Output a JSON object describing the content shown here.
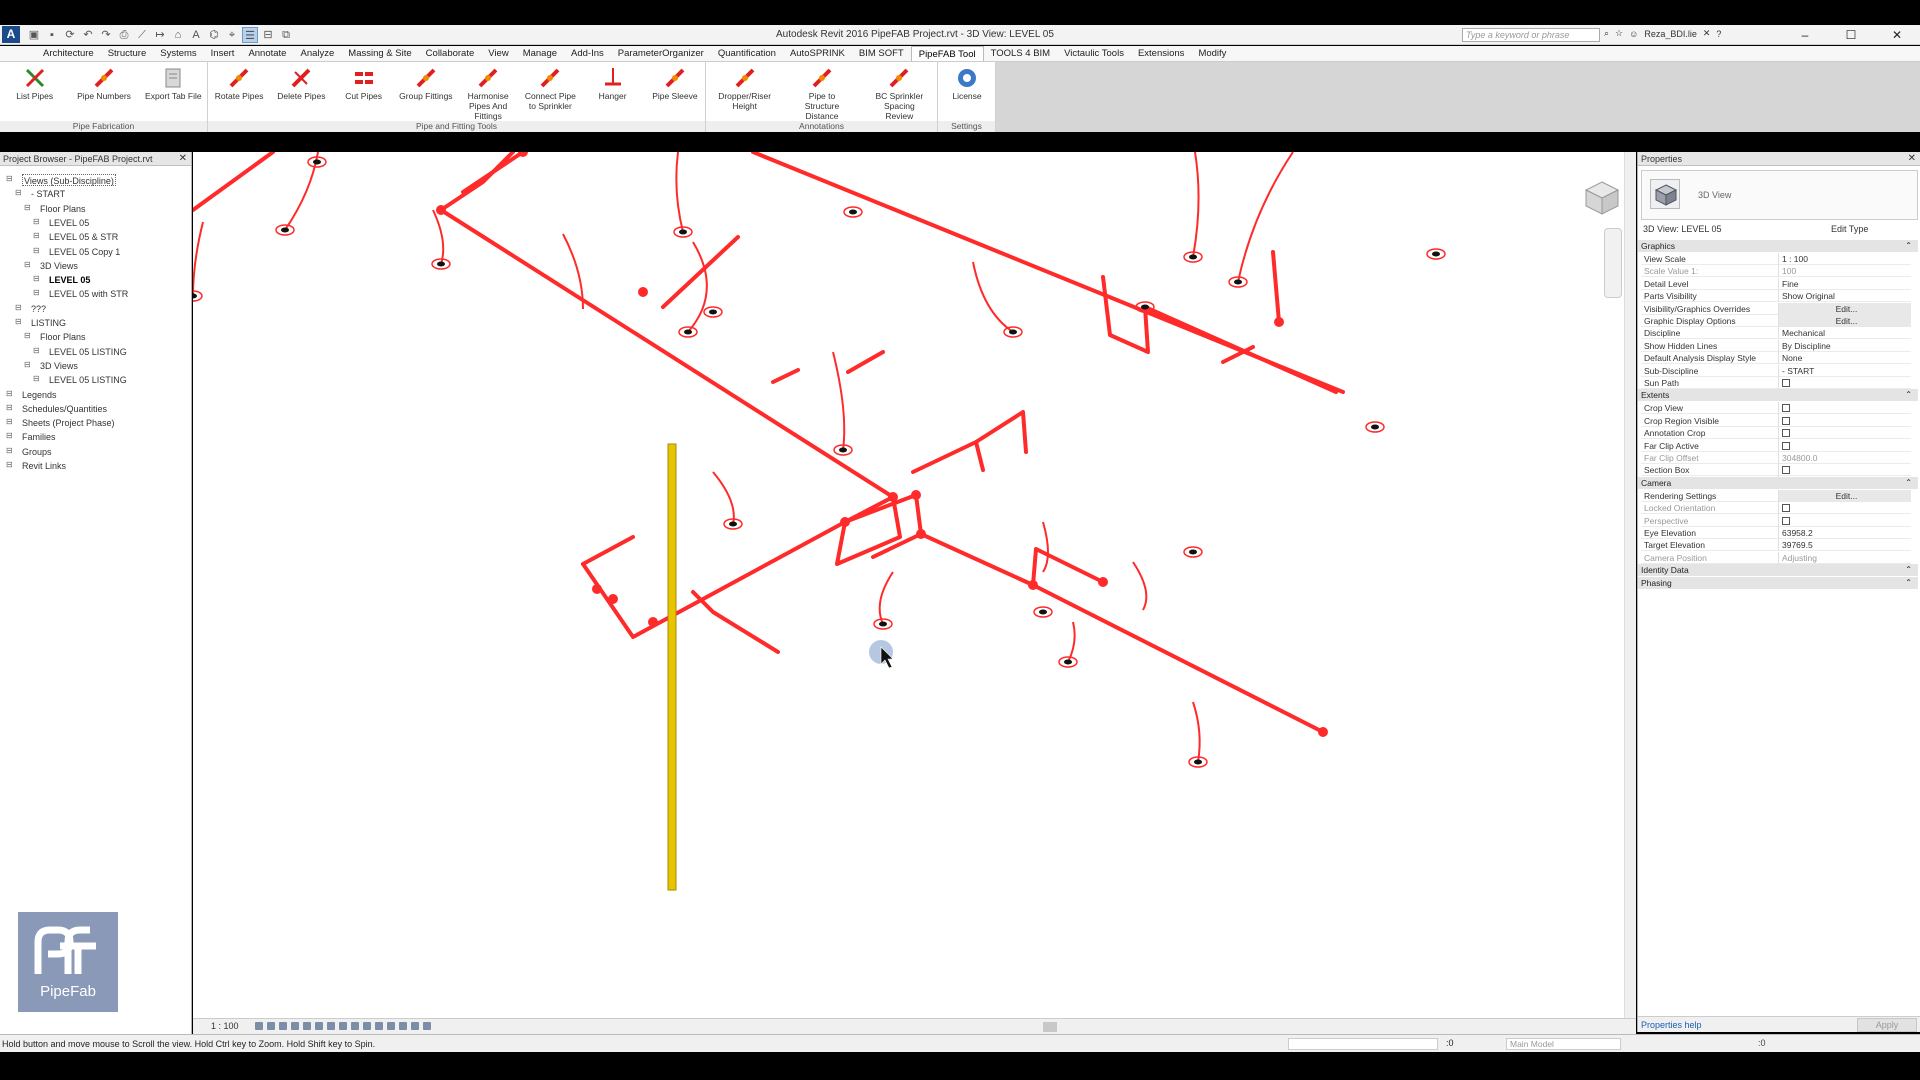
{
  "app": {
    "logo_letter": "A",
    "window_title": "Autodesk Revit 2016      PipeFAB Project.rvt - 3D View: LEVEL 05",
    "search_placeholder": "Type a keyword or phrase",
    "user": "Reza_BDI.lie"
  },
  "quick_access": [
    {
      "icon": "folder-icon",
      "glyph": "▣"
    },
    {
      "icon": "save-icon",
      "glyph": "▪"
    },
    {
      "icon": "sync-icon",
      "glyph": "⟳"
    },
    {
      "icon": "undo-icon",
      "glyph": "↶"
    },
    {
      "icon": "redo-icon",
      "glyph": "↷"
    },
    {
      "icon": "print-icon",
      "glyph": "⎙"
    },
    {
      "icon": "measure-icon",
      "glyph": "⟋"
    },
    {
      "icon": "dimension-icon",
      "glyph": "↦"
    },
    {
      "icon": "tag-icon",
      "glyph": "⌂"
    },
    {
      "icon": "text-icon",
      "glyph": "A"
    },
    {
      "icon": "3d-view-icon",
      "glyph": "⌬"
    },
    {
      "icon": "section-icon",
      "glyph": "⌖"
    },
    {
      "icon": "thin-lines-icon",
      "glyph": "☰",
      "active": true
    },
    {
      "icon": "close-hidden-icon",
      "glyph": "⊟"
    },
    {
      "icon": "switch-windows-icon",
      "glyph": "⧉"
    }
  ],
  "ribbon_tabs": [
    "Architecture",
    "Structure",
    "Systems",
    "Insert",
    "Annotate",
    "Analyze",
    "Massing & Site",
    "Collaborate",
    "View",
    "Manage",
    "Add-Ins",
    "ParameterOrganizer",
    "Quantification",
    "AutoSPRINK",
    "BIM SOFT",
    "PipeFAB Tool",
    "TOOLS 4 BIM",
    "Victaulic Tools",
    "Extensions",
    "Modify"
  ],
  "active_tab_index": 15,
  "ribbon_groups": [
    {
      "label": "Pipe Fabrication",
      "buttons": [
        "List Pipes",
        "Pipe Numbers",
        "Export Tab File"
      ]
    },
    {
      "label": "Pipe and Fitting Tools",
      "buttons": [
        "Rotate Pipes",
        "Delete Pipes",
        "Cut Pipes",
        "Group Fittings",
        "Harmonise\nPipes And\nFittings",
        "Connect Pipe\nto Sprinkler",
        "Hanger",
        "Pipe Sleeve"
      ]
    },
    {
      "label": "Annotations",
      "buttons": [
        "Dropper/Riser\nHeight",
        "Pipe to\nStructure Distance",
        "BC Sprinkler\nSpacing Review"
      ]
    },
    {
      "label": "Settings",
      "buttons": [
        "License"
      ]
    }
  ],
  "project_browser": {
    "title": "Project Browser - PipeFAB Project.rvt",
    "items": [
      {
        "label": "Views (Sub-Discipline)",
        "indent": 0,
        "sel": true
      },
      {
        "label": "- START",
        "indent": 1
      },
      {
        "label": "Floor Plans",
        "indent": 2
      },
      {
        "label": "LEVEL 05",
        "indent": 3
      },
      {
        "label": "LEVEL 05 & STR",
        "indent": 3
      },
      {
        "label": "LEVEL 05 Copy 1",
        "indent": 3
      },
      {
        "label": "3D Views",
        "indent": 2
      },
      {
        "label": "LEVEL 05",
        "indent": 3,
        "bold": true
      },
      {
        "label": "LEVEL 05 with STR",
        "indent": 3
      },
      {
        "label": "???",
        "indent": 1
      },
      {
        "label": "LISTING",
        "indent": 1
      },
      {
        "label": "Floor Plans",
        "indent": 2
      },
      {
        "label": "LEVEL 05 LISTING",
        "indent": 3
      },
      {
        "label": "3D Views",
        "indent": 2
      },
      {
        "label": "LEVEL 05 LISTING",
        "indent": 3
      },
      {
        "label": "Legends",
        "indent": 0
      },
      {
        "label": "Schedules/Quantities",
        "indent": 0
      },
      {
        "label": "Sheets (Project Phase)",
        "indent": 0
      },
      {
        "label": "Families",
        "indent": 0
      },
      {
        "label": "Groups",
        "indent": 0
      },
      {
        "label": "Revit Links",
        "indent": 0
      }
    ]
  },
  "logo_text": "PipeFab",
  "viewbar": {
    "scale": "1 : 100"
  },
  "properties": {
    "title": "Properties",
    "type_name": "3D View",
    "instance": "3D View: LEVEL 05",
    "edit_type": "Edit Type",
    "groups": [
      {
        "name": "Graphics",
        "rows": [
          {
            "label": "View Scale",
            "value": "1 : 100"
          },
          {
            "label": "Scale Value    1:",
            "value": "100",
            "disabled": true
          },
          {
            "label": "Detail Level",
            "value": "Fine"
          },
          {
            "label": "Parts Visibility",
            "value": "Show Original"
          },
          {
            "label": "Visibility/Graphics Overrides",
            "value": "Edit...",
            "button": true
          },
          {
            "label": "Graphic Display Options",
            "value": "Edit...",
            "button": true
          },
          {
            "label": "Discipline",
            "value": "Mechanical"
          },
          {
            "label": "Show Hidden Lines",
            "value": "By Discipline"
          },
          {
            "label": "Default Analysis Display Style",
            "value": "None"
          },
          {
            "label": "Sub-Discipline",
            "value": "- START"
          },
          {
            "label": "Sun Path",
            "check": true
          }
        ]
      },
      {
        "name": "Extents",
        "rows": [
          {
            "label": "Crop View",
            "check": true
          },
          {
            "label": "Crop Region Visible",
            "check": true
          },
          {
            "label": "Annotation Crop",
            "check": true
          },
          {
            "label": "Far Clip Active",
            "check": true
          },
          {
            "label": "Far Clip Offset",
            "value": "304800.0",
            "disabled": true
          },
          {
            "label": "Section Box",
            "check": true
          }
        ]
      },
      {
        "name": "Camera",
        "rows": [
          {
            "label": "Rendering Settings",
            "value": "Edit...",
            "button": true
          },
          {
            "label": "Locked Orientation",
            "check": true,
            "disabled": true
          },
          {
            "label": "Perspective",
            "check": true,
            "disabled": true
          },
          {
            "label": "Eye Elevation",
            "value": "63958.2"
          },
          {
            "label": "Target Elevation",
            "value": "39769.5"
          },
          {
            "label": "Camera Position",
            "value": "Adjusting",
            "disabled": true
          }
        ]
      },
      {
        "name": "Identity Data",
        "rows": []
      },
      {
        "name": "Phasing",
        "rows": []
      }
    ],
    "help": "Properties help",
    "apply": "Apply"
  },
  "statusbar": {
    "message": "Hold button and move mouse to Scroll the view. Hold Ctrl key to Zoom. Hold Shift key to Spin.",
    "selection_count": ":0",
    "model": "Main Model",
    "filter_count": ":0"
  },
  "colors": {
    "pipe": "#ff2a2a",
    "riser": "#e8c400",
    "accent": "#1b4b8a"
  }
}
